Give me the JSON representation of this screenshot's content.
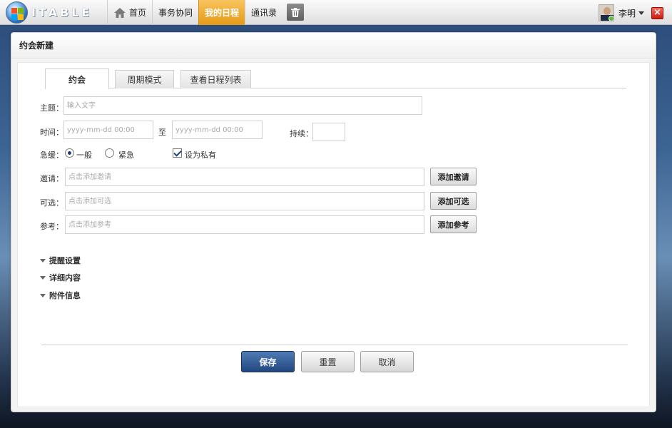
{
  "app": {
    "logo_text": "ITABLE",
    "nav": [
      {
        "label": "首页",
        "icon": "home-icon"
      },
      {
        "label": "事务协同"
      },
      {
        "label": "我的日程",
        "active": true
      },
      {
        "label": "通讯录"
      }
    ],
    "trash_icon": "trash-icon",
    "user": {
      "name": "李明",
      "status": "online"
    },
    "accent_color": "#f0a020"
  },
  "panel": {
    "title": "约会新建",
    "tabs": [
      {
        "label": "约会",
        "active": true
      },
      {
        "label": "周期模式"
      },
      {
        "label": "查看日程列表"
      }
    ]
  },
  "form": {
    "subject": {
      "label": "主题：",
      "placeholder": "输入文字",
      "value": ""
    },
    "time": {
      "label": "时间：",
      "start_placeholder": "yyyy-mm-dd 00:00",
      "to_label": "至",
      "end_placeholder": "yyyy-mm-dd 00:00",
      "duration_label": "持续：",
      "duration_value": ""
    },
    "urgency": {
      "label": "急缓：",
      "options": [
        {
          "label": "一般",
          "checked": true
        },
        {
          "label": "紧急",
          "checked": false
        }
      ],
      "private": {
        "label": "设为私有",
        "checked": true
      }
    },
    "invite": {
      "label": "邀请：",
      "placeholder": "点击添加邀请",
      "button": "添加邀请"
    },
    "optional": {
      "label": "可选：",
      "placeholder": "点击添加可选",
      "button": "添加可选"
    },
    "reference": {
      "label": "参考：",
      "placeholder": "点击添加参考",
      "button": "添加参考"
    },
    "sections": [
      "提醒设置",
      "详细内容",
      "附件信息"
    ]
  },
  "actions": {
    "save": "保存",
    "reset": "重置",
    "cancel": "取消"
  }
}
